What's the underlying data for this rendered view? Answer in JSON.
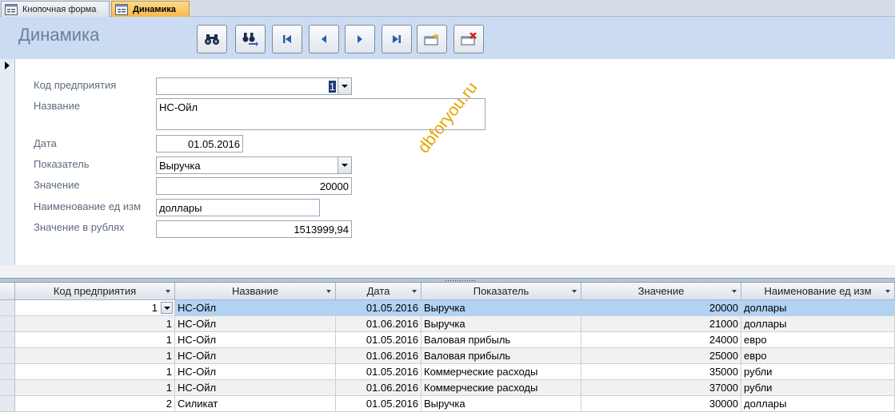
{
  "tabs": [
    {
      "label": "Кнопочная форма",
      "active": false
    },
    {
      "label": "Динамика",
      "active": true
    }
  ],
  "form": {
    "title": "Динамика",
    "toolbar": {
      "find_icon": "binoculars-icon",
      "replace_icon": "find-replace-icon",
      "first_icon": "first-record-icon",
      "prev_icon": "prev-record-icon",
      "next_icon": "next-record-icon",
      "last_icon": "last-record-icon",
      "new_icon": "new-record-icon",
      "delete_icon": "delete-record-icon"
    },
    "fields": {
      "kod_label": "Код  предприятия",
      "kod_value": "1",
      "nazvanie_label": "Название",
      "nazvanie_value": "НС-Ойл",
      "data_label": "Дата",
      "data_value": "01.05.2016",
      "pokazatel_label": "Показатель",
      "pokazatel_value": "Выручка",
      "znachenie_label": "Значение",
      "znachenie_value": "20000",
      "ed_label": "Наименование ед изм",
      "ed_value": "доллары",
      "rub_label": "Значение в рублях",
      "rub_value": "1513999,94"
    },
    "watermark": "dbforyou.ru"
  },
  "datasheet": {
    "columns": [
      "Код  предприятия",
      "Название",
      "Дата",
      "Показатель",
      "Значение",
      "Наименование ед изм"
    ],
    "rows": [
      {
        "kod": "1",
        "name": "НС-Ойл",
        "date": "01.05.2016",
        "ind": "Выручка",
        "val": "20000",
        "unit": "доллары"
      },
      {
        "kod": "1",
        "name": "НС-Ойл",
        "date": "01.06.2016",
        "ind": "Выручка",
        "val": "21000",
        "unit": "доллары"
      },
      {
        "kod": "1",
        "name": "НС-Ойл",
        "date": "01.05.2016",
        "ind": "Валовая прибыль",
        "val": "24000",
        "unit": "евро"
      },
      {
        "kod": "1",
        "name": "НС-Ойл",
        "date": "01.06.2016",
        "ind": "Валовая прибыль",
        "val": "25000",
        "unit": "евро"
      },
      {
        "kod": "1",
        "name": "НС-Ойл",
        "date": "01.05.2016",
        "ind": "Коммерческие расходы",
        "val": "35000",
        "unit": "рубли"
      },
      {
        "kod": "1",
        "name": "НС-Ойл",
        "date": "01.06.2016",
        "ind": "Коммерческие расходы",
        "val": "37000",
        "unit": "рубли"
      },
      {
        "kod": "2",
        "name": "Силикат",
        "date": "01.05.2016",
        "ind": "Выручка",
        "val": "30000",
        "unit": "доллары"
      }
    ]
  },
  "colors": {
    "header_bg": "#cbdcf2",
    "active_tab": "#f7b94b",
    "selected_row": "#b2d2f4",
    "watermark": "#e6a200"
  }
}
